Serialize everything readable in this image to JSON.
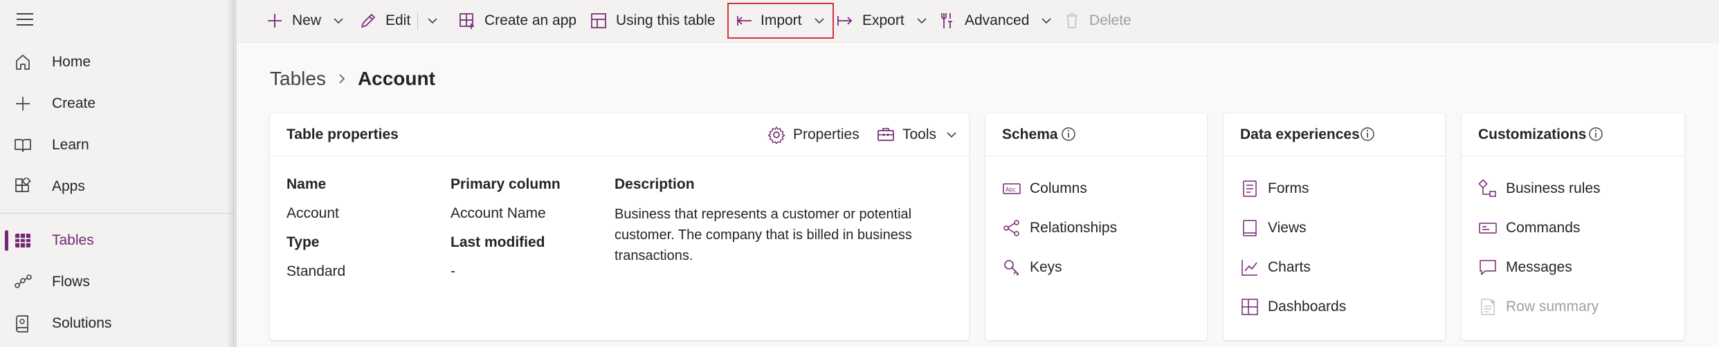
{
  "sidebar": {
    "items": [
      {
        "label": "Home",
        "icon": "home-icon"
      },
      {
        "label": "Create",
        "icon": "plus-icon"
      },
      {
        "label": "Learn",
        "icon": "book-icon"
      },
      {
        "label": "Apps",
        "icon": "apps-icon"
      },
      {
        "label": "Tables",
        "icon": "table-icon",
        "active": true
      },
      {
        "label": "Flows",
        "icon": "flow-icon"
      },
      {
        "label": "Solutions",
        "icon": "solutions-icon"
      }
    ]
  },
  "commandbar": {
    "new": "New",
    "edit": "Edit",
    "create_app": "Create an app",
    "using_table": "Using this table",
    "import": "Import",
    "export": "Export",
    "advanced": "Advanced",
    "delete": "Delete"
  },
  "breadcrumb": {
    "root": "Tables",
    "current": "Account"
  },
  "table_properties": {
    "title": "Table properties",
    "properties_btn": "Properties",
    "tools_btn": "Tools",
    "name_label": "Name",
    "name_value": "Account",
    "type_label": "Type",
    "type_value": "Standard",
    "primary_label": "Primary column",
    "primary_value": "Account Name",
    "modified_label": "Last modified",
    "modified_value": "-",
    "description_label": "Description",
    "description_value": "Business that represents a customer or potential customer. The company that is billed in business transactions."
  },
  "schema": {
    "title": "Schema",
    "items": [
      "Columns",
      "Relationships",
      "Keys"
    ]
  },
  "data_experiences": {
    "title": "Data experiences",
    "items": [
      "Forms",
      "Views",
      "Charts",
      "Dashboards"
    ]
  },
  "customizations": {
    "title": "Customizations",
    "items": [
      "Business rules",
      "Commands",
      "Messages",
      "Row summary"
    ]
  },
  "colors": {
    "accent": "#742774",
    "highlight": "#d13438",
    "disabled": "#a19f9d"
  }
}
